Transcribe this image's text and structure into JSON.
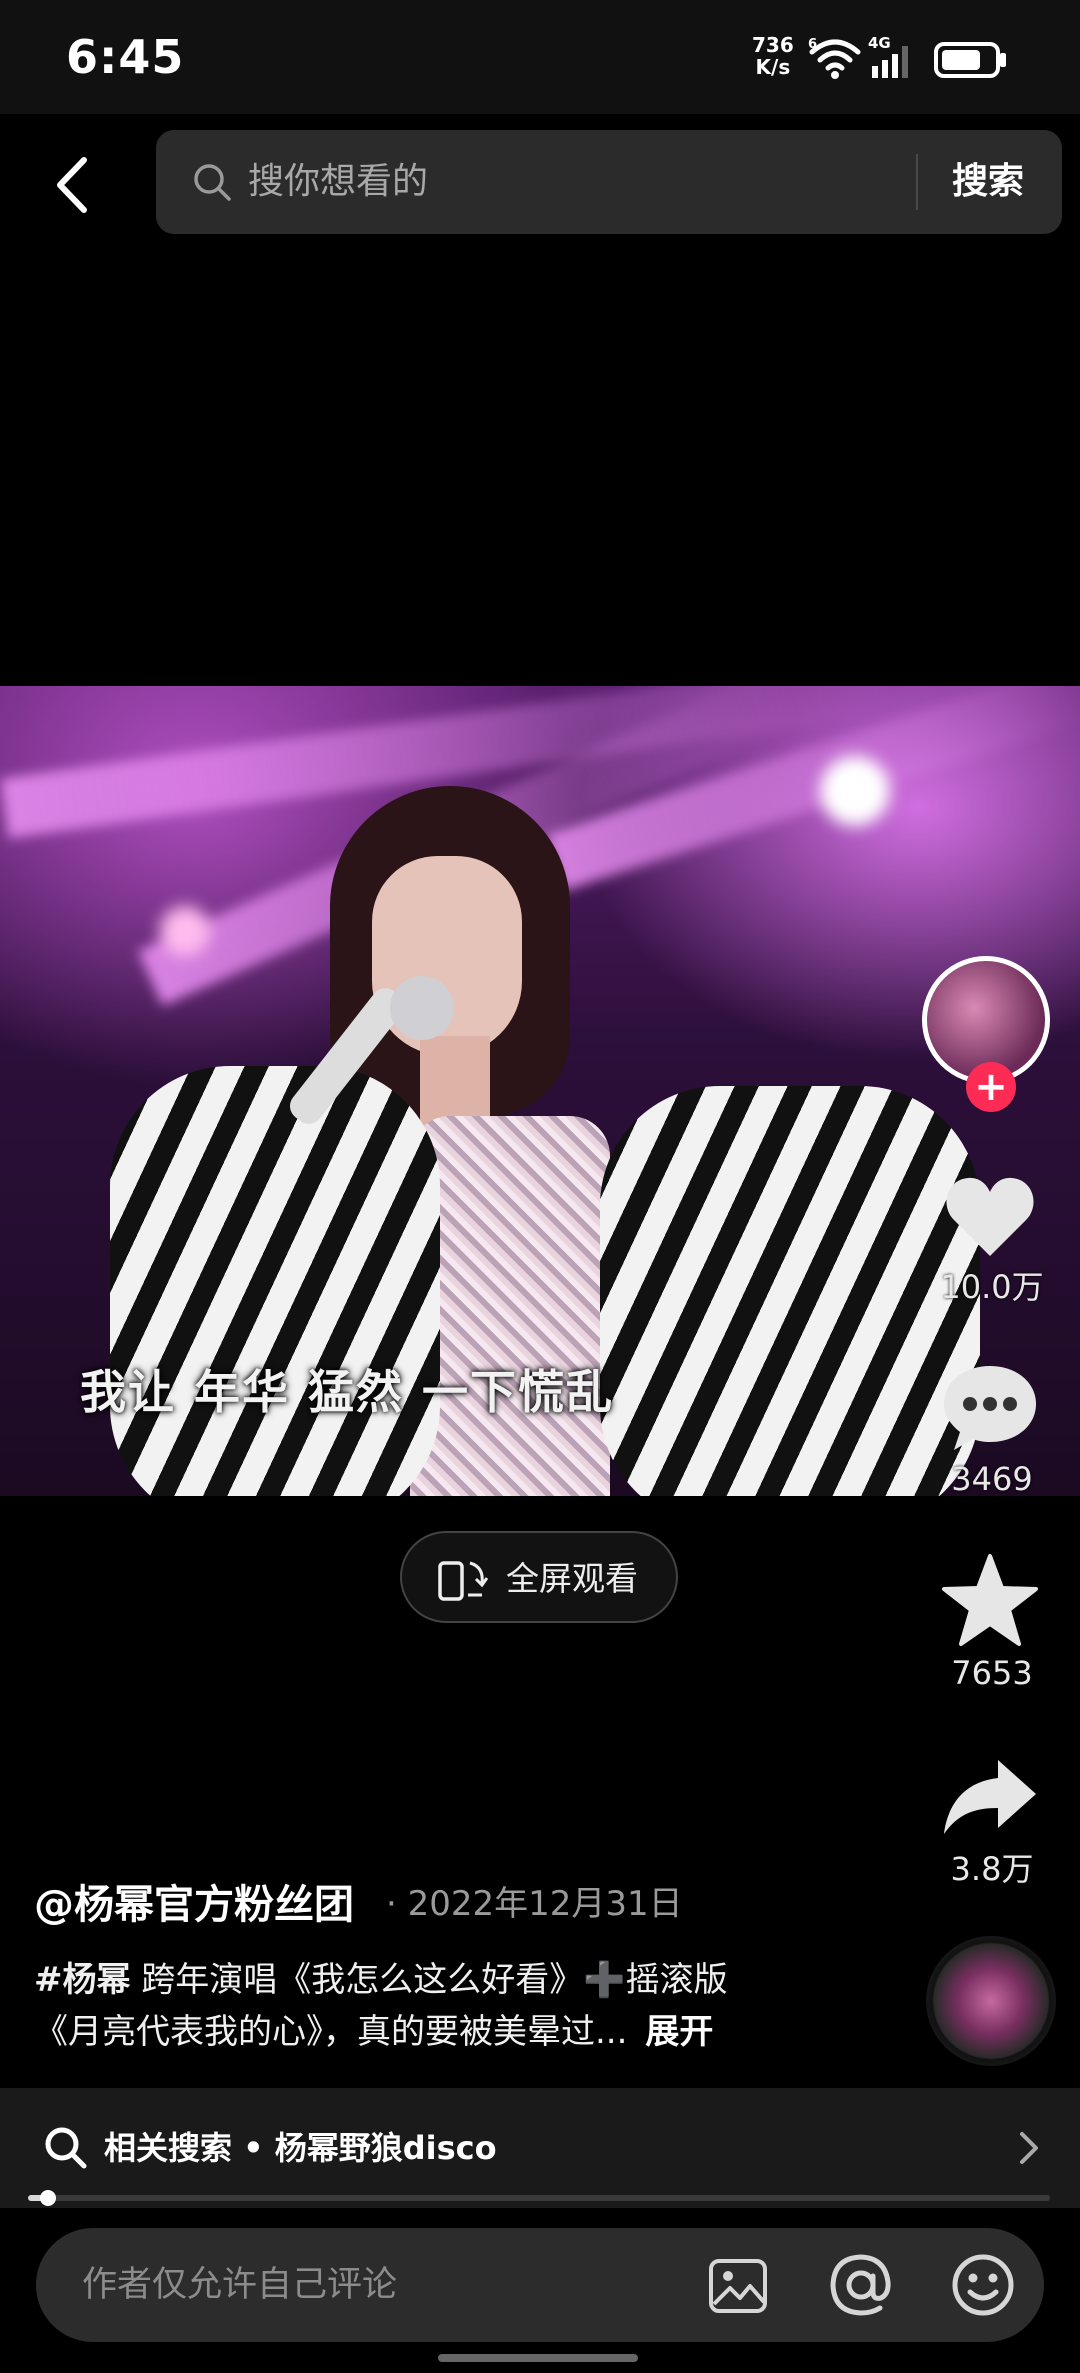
{
  "status_bar": {
    "time": "6:45",
    "net_speed_value": "736",
    "net_speed_unit": "K/s",
    "signal_label": "4G",
    "wifi_label": "6",
    "battery_level": 0.75
  },
  "search": {
    "placeholder": "搜你想看的",
    "button_label": "搜索"
  },
  "video": {
    "subtitle": "我让 年华 猛然 一下慌乱"
  },
  "actions": {
    "likes": "10.0万",
    "comments": "3469",
    "favorites": "7653",
    "shares": "3.8万"
  },
  "fullscreen": {
    "label": "全屏观看"
  },
  "post": {
    "author": "@杨幂官方粉丝团",
    "date": "· 2022年12月31日",
    "hashtag": "#杨幂",
    "caption_line1": " 跨年演唱《我怎么这么好看》➕摇滚版",
    "caption_line2": "《月亮代表我的心》，真的要被美晕过...",
    "expand_label": "展开"
  },
  "related": {
    "label": "相关搜索 • 杨幂野狼disco",
    "progress": 0.02
  },
  "comment_bar": {
    "placeholder": "作者仅允许自己评论"
  },
  "colors": {
    "accent_red": "#fe2c55",
    "background": "#000000",
    "search_bg": "#2b2b2b"
  }
}
